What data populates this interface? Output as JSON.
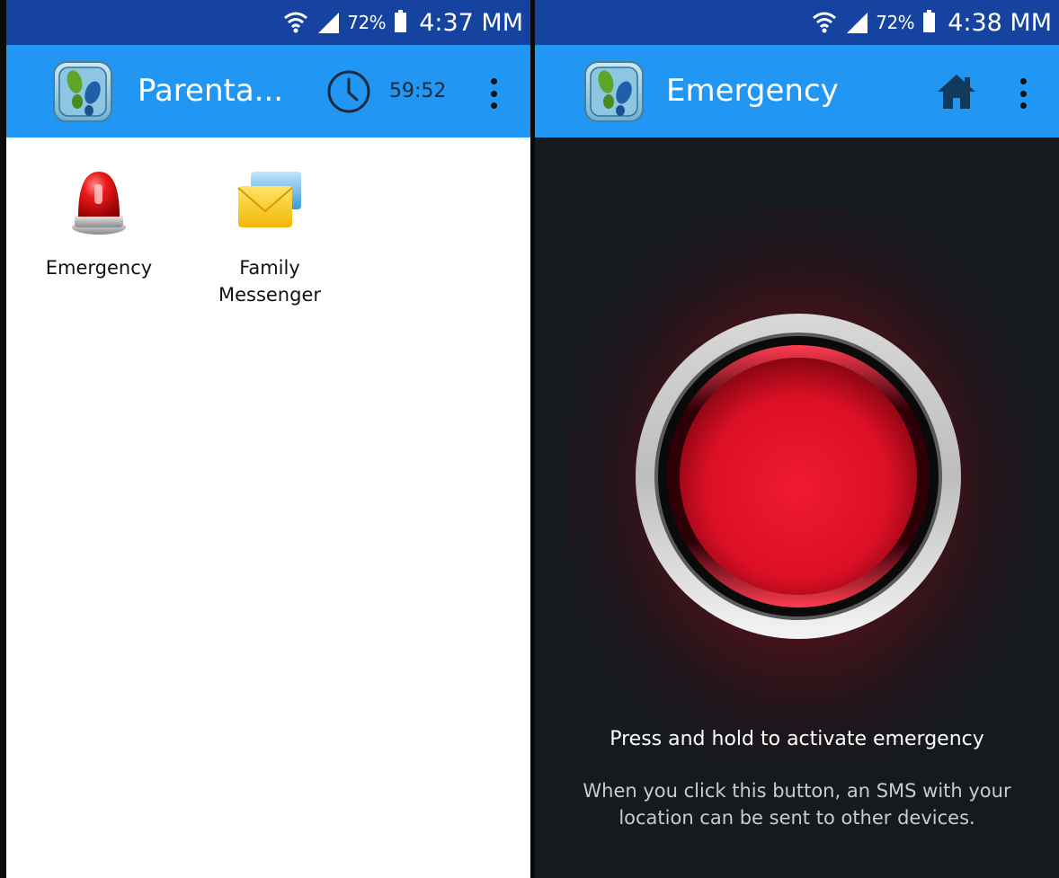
{
  "left_screen": {
    "status": {
      "battery_percent": "72%",
      "time": "4:37 MM"
    },
    "appbar": {
      "title": "Parenta...",
      "timer": "59:52"
    },
    "apps": [
      {
        "label": "Emergency",
        "icon": "siren-icon"
      },
      {
        "label_line1": "Family",
        "label_line2": "Messenger",
        "icon": "envelope-icon"
      }
    ]
  },
  "right_screen": {
    "status": {
      "battery_percent": "72%",
      "time": "4:38 MM"
    },
    "appbar": {
      "title": "Emergency",
      "icon": "home-icon"
    },
    "instruction": "Press and hold to activate emergency",
    "description_line1": "When you click this button, an SMS with your",
    "description_line2": "location can be sent to other devices."
  },
  "colors": {
    "status_bar": "#1743a0",
    "app_bar": "#2196f3",
    "emergency_background": "#151a1f",
    "button_red": "#e8112d"
  }
}
